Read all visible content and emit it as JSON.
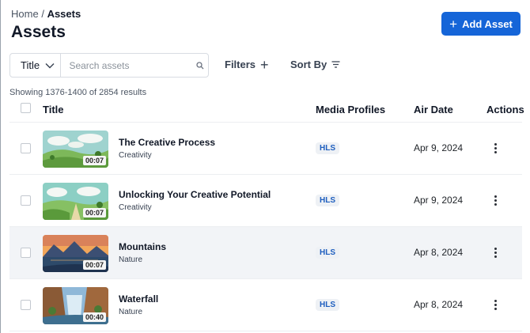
{
  "breadcrumb": {
    "home": "Home",
    "separator": "/",
    "current": "Assets"
  },
  "page": {
    "title": "Assets"
  },
  "toolbar": {
    "add_label": "Add Asset"
  },
  "search": {
    "field_select": "Title",
    "placeholder": "Search assets"
  },
  "filters": {
    "label": "Filters"
  },
  "sort": {
    "label": "Sort By"
  },
  "results": {
    "text": "Showing 1376-1400 of 2854 results"
  },
  "table": {
    "headers": {
      "title": "Title",
      "media_profiles": "Media Profiles",
      "air_date": "Air Date",
      "actions": "Actions"
    },
    "rows": [
      {
        "title": "The Creative Process",
        "category": "Creativity",
        "duration": "00:07",
        "profile": "HLS",
        "air_date": "Apr 9, 2024",
        "thumbnail": "green-hills-clouds"
      },
      {
        "title": "Unlocking Your Creative Potential",
        "category": "Creativity",
        "duration": "00:07",
        "profile": "HLS",
        "air_date": "Apr 9, 2024",
        "thumbnail": "green-valley-path"
      },
      {
        "title": "Mountains",
        "category": "Nature",
        "duration": "00:07",
        "profile": "HLS",
        "air_date": "Apr 8, 2024",
        "thumbnail": "mountain-lake-sunset"
      },
      {
        "title": "Waterfall",
        "category": "Nature",
        "duration": "00:40",
        "profile": "HLS",
        "air_date": "Apr 8, 2024",
        "thumbnail": "canyon-waterfall"
      }
    ]
  },
  "colors": {
    "accent": "#1565d8",
    "badge_text": "#1f5fbf",
    "badge_bg": "#eef1f5",
    "row_highlight": "#f2f4f7"
  },
  "icons": [
    "plus-icon",
    "chevron-down-icon",
    "search-icon",
    "filter-lines-icon",
    "more-vertical-icon"
  ]
}
